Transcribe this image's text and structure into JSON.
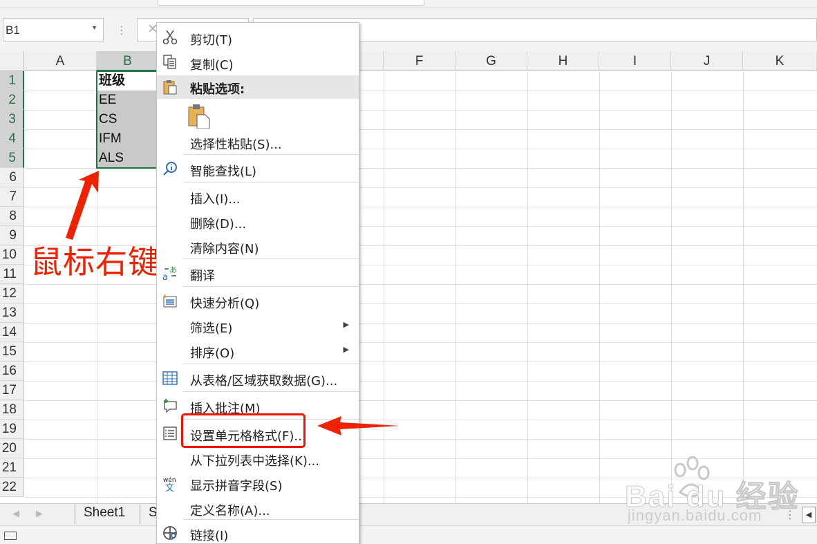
{
  "namebox": {
    "value": "B1"
  },
  "columns": [
    "A",
    "B",
    "F",
    "G",
    "H",
    "I",
    "J",
    "K"
  ],
  "rows": [
    "1",
    "2",
    "3",
    "4",
    "5",
    "6",
    "7",
    "8",
    "9",
    "10",
    "11",
    "12",
    "13",
    "14",
    "15",
    "16",
    "17",
    "18",
    "19",
    "20",
    "21",
    "22"
  ],
  "cells": {
    "B1": "班级",
    "B2": "EE",
    "B3": "CS",
    "B4": "IFM",
    "B5": "ALS"
  },
  "annotation": {
    "label": "鼠标右键"
  },
  "sheet_tabs": [
    "Sheet1",
    "S"
  ],
  "context_menu": {
    "items": [
      {
        "label": "剪切(T)",
        "icon": "scissors-icon"
      },
      {
        "label": "复制(C)",
        "icon": "copy-icon"
      },
      {
        "label": "粘贴选项:",
        "icon": "paste-icon"
      },
      {
        "label": "选择性粘贴(S)...",
        "icon": ""
      },
      {
        "label": "智能查找(L)",
        "icon": "smart-lookup-icon"
      },
      {
        "label": "插入(I)...",
        "icon": ""
      },
      {
        "label": "删除(D)...",
        "icon": ""
      },
      {
        "label": "清除内容(N)",
        "icon": ""
      },
      {
        "label": "翻译",
        "icon": "translate-icon"
      },
      {
        "label": "快速分析(Q)",
        "icon": "quick-analysis-icon"
      },
      {
        "label": "筛选(E)",
        "icon": ""
      },
      {
        "label": "排序(O)",
        "icon": ""
      },
      {
        "label": "从表格/区域获取数据(G)...",
        "icon": "table-icon"
      },
      {
        "label": "插入批注(M)",
        "icon": "comment-icon"
      },
      {
        "label": "设置单元格格式(F)...",
        "icon": "format-cells-icon"
      },
      {
        "label": "从下拉列表中选择(K)...",
        "icon": ""
      },
      {
        "label": "显示拼音字段(S)",
        "icon": "pinyin-icon"
      },
      {
        "label": "定义名称(A)...",
        "icon": ""
      },
      {
        "label": "链接(I)",
        "icon": "link-icon"
      }
    ]
  },
  "watermark": {
    "logo": "Bai du 经验",
    "url": "jingyan.baidu.com"
  },
  "colors": {
    "accent": "#217346",
    "annotation": "#ee2200"
  }
}
